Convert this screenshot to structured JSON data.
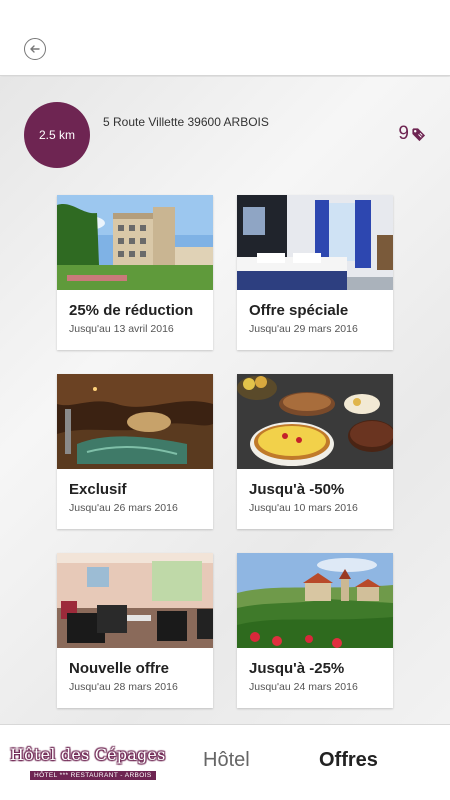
{
  "header": {
    "back_icon": "back-arrow-icon"
  },
  "location": {
    "distance": "2.5 km",
    "address": "5 Route Villette 39600 ARBOIS",
    "offer_count": "9",
    "offer_icon": "tag-icon",
    "accent_color": "#6e2552"
  },
  "offers": [
    {
      "title": "25% de réduction",
      "date": "Jusqu'au 13 avril 2016"
    },
    {
      "title": "Offre spéciale",
      "date": "Jusqu'au 29 mars 2016"
    },
    {
      "title": "Exclusif",
      "date": "Jusqu'au 26 mars 2016"
    },
    {
      "title": "Jusqu'à -50%",
      "date": "Jusqu'au 10 mars 2016"
    },
    {
      "title": "Nouvelle offre",
      "date": "Jusqu'au 28 mars 2016"
    },
    {
      "title": "Jusqu'à -25%",
      "date": "Jusqu'au 24 mars 2016"
    }
  ],
  "bottom_nav": {
    "logo_main": "Hôtel des Cépages",
    "logo_sub": "HÔTEL *** RESTAURANT - ARBOIS",
    "tabs": [
      "Hôtel",
      "Offres"
    ],
    "active_tab": "Offres"
  }
}
